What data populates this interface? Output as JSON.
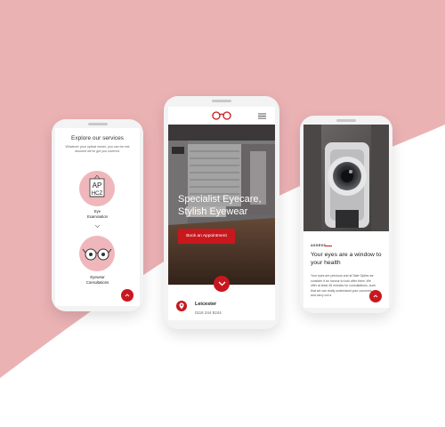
{
  "colors": {
    "accent": "#c8181e",
    "pink_band": "#ebb2b4",
    "service_circle": "#efb7bc",
    "page_bg": "#ffffff"
  },
  "phone_services": {
    "title": "Explore our services",
    "intro": "Whatever your optical needs, you can be rest assured we've got you covered.",
    "services": [
      {
        "label_line1": "Eye",
        "label_line2": "Examination",
        "icon": "eye-chart-icon"
      },
      {
        "label_line1": "Eyewear",
        "label_line2": "Consultations",
        "icon": "glasses-icon"
      }
    ],
    "scroll_top_icon": "chevron-up-icon"
  },
  "phone_home": {
    "logo_icon": "glasses-logo-icon",
    "menu_icon": "hamburger-menu-icon",
    "hero_line1": "Specialist Eyecare,",
    "hero_line2": "Stylish Eyewear",
    "cta_label": "Book an Appointment",
    "scroll_icon": "chevron-down-icon",
    "location_icon": "map-pin-icon",
    "location_name": "Leicester",
    "location_phone": "0116 244 8244"
  },
  "phone_assess": {
    "kicker": "ASSESS",
    "title": "Your eyes are a window to your health",
    "body": "Your eyes are precious and at Sale Optics we consider it an honour to look after them. We offer at least 45 minutes for consultations, such that we can really understand your concerns and carry out a",
    "scroll_top_icon": "chevron-up-icon"
  }
}
